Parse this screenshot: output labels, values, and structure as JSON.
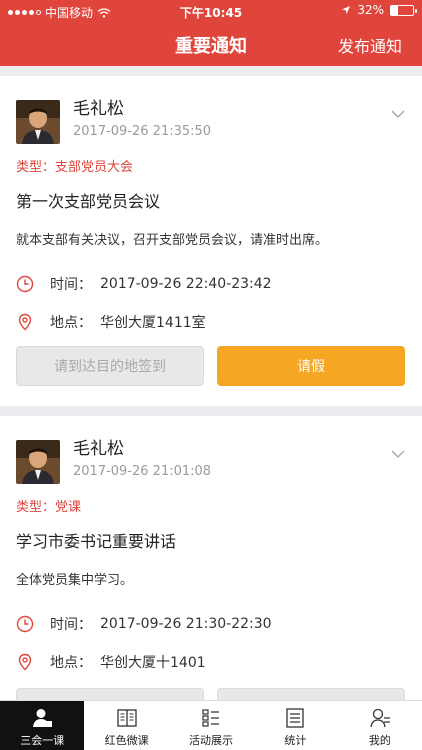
{
  "status_bar": {
    "carrier": "中国移动",
    "time": "下午10:45",
    "battery": "32%",
    "battery_level": 0.32
  },
  "nav": {
    "title": "重要通知",
    "action_label": "发布通知"
  },
  "notices": [
    {
      "author": "毛礼松",
      "timestamp": "2017-09-26 21:35:50",
      "type": "类型：支部党员大会",
      "subject": "第一次支部党员会议",
      "description": "就本支部有关决议，召开支部党员会议，请准时出席。",
      "time_label": "时间：",
      "time_value": "2017-09-26 22:40-23:42",
      "location_label": "地点：",
      "location_value": "华创大厦1411室",
      "checkin_label": "请到达目的地签到",
      "leave_label": "请假"
    },
    {
      "author": "毛礼松",
      "timestamp": "2017-09-26 21:01:08",
      "type": "类型：党课",
      "subject": "学习市委书记重要讲话",
      "description": "全体党员集中学习。",
      "time_label": "时间：",
      "time_value": "2017-09-26 21:30-22:30",
      "location_label": "地点：",
      "location_value": "华创大厦十1401"
    }
  ],
  "tabs": [
    {
      "label": "三会一课",
      "icon": "person-icon",
      "active": true
    },
    {
      "label": "红色微课",
      "icon": "book-icon",
      "active": false
    },
    {
      "label": "活动展示",
      "icon": "list-icon",
      "active": false
    },
    {
      "label": "统计",
      "icon": "document-icon",
      "active": false
    },
    {
      "label": "我的",
      "icon": "profile-icon",
      "active": false
    }
  ],
  "colors": {
    "brand_red": "#e0453c",
    "leave_orange": "#f5a623"
  }
}
